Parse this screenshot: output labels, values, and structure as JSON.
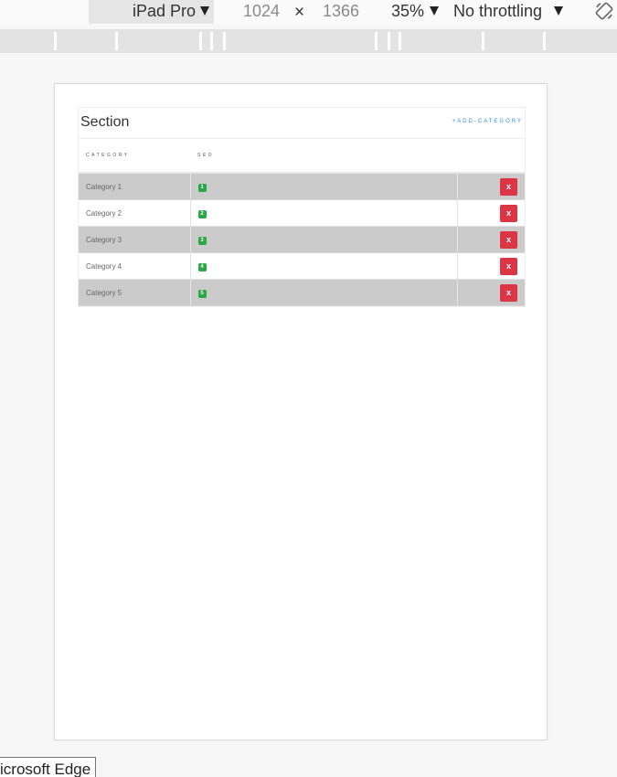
{
  "devtools": {
    "device": "iPad Pro",
    "width": "1024",
    "times": "×",
    "height": "1366",
    "zoom": "35%",
    "throttling": "No throttling"
  },
  "section": {
    "title": "Section",
    "add_label": "+ADD-CATEGORY"
  },
  "table": {
    "headers": [
      "CATEGORY",
      "SEO",
      ""
    ],
    "rows": [
      {
        "name": "Category 1",
        "seo": "1",
        "action": "x"
      },
      {
        "name": "Category 2",
        "seo": "2",
        "action": "x"
      },
      {
        "name": "Category 3",
        "seo": "3",
        "action": "x"
      },
      {
        "name": "Category 4",
        "seo": "4",
        "action": "x"
      },
      {
        "name": "Category 5",
        "seo": "5",
        "action": "x"
      }
    ]
  },
  "tooltip": {
    "text": "icrosoft Edge"
  },
  "colors": {
    "link": "#2f8fd8",
    "badge": "#28a745",
    "delete": "#dc3545",
    "striped_row": "#cbcbcb"
  },
  "icons": {
    "rotate": "rotate-icon",
    "dropdown": "caret-down-icon"
  }
}
